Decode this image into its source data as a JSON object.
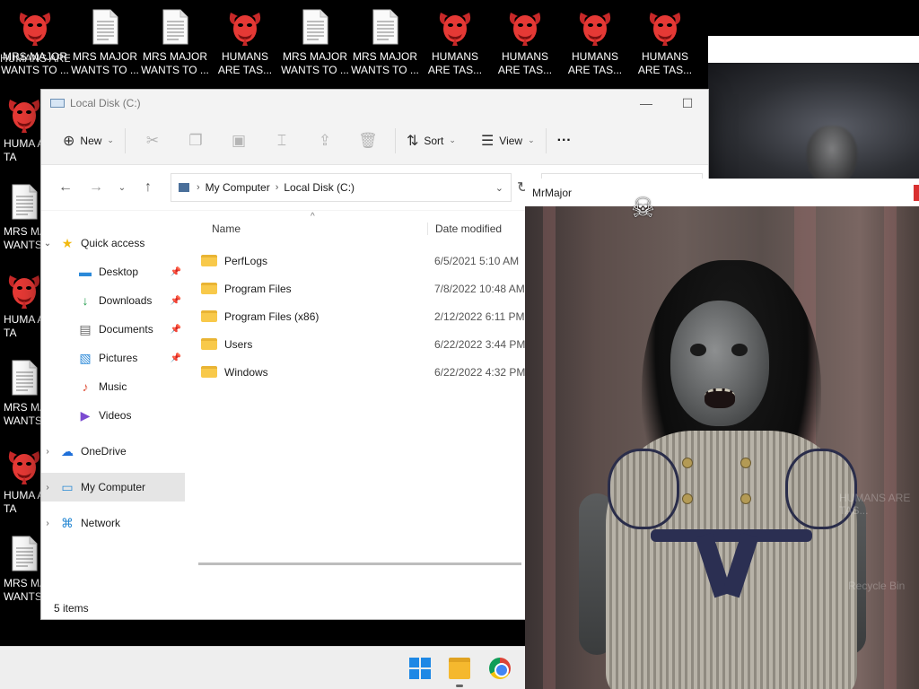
{
  "desktop": {
    "top_row": [
      {
        "label": "MRS MAJOR WANTS TO ...",
        "icon": "devil-icon",
        "overlay": "HUMANS ARE TAS..."
      },
      {
        "label": "MRS MAJOR WANTS TO ...",
        "icon": "doc-icon"
      },
      {
        "label": "MRS MAJOR WANTS TO ...",
        "icon": "doc-icon"
      },
      {
        "label": "HUMANS ARE TAS...",
        "icon": "devil-icon"
      },
      {
        "label": "MRS MAJOR WANTS TO ...",
        "icon": "doc-icon"
      },
      {
        "label": "MRS MAJOR WANTS TO ...",
        "icon": "doc-icon"
      },
      {
        "label": "HUMANS ARE TAS...",
        "icon": "devil-icon"
      },
      {
        "label": "HUMANS ARE TAS...",
        "icon": "devil-icon"
      },
      {
        "label": "HUMANS ARE TAS...",
        "icon": "devil-icon"
      },
      {
        "label": "HUMANS ARE TAS...",
        "icon": "devil-icon"
      }
    ],
    "left_column": [
      {
        "label": "HUMA ARE TA",
        "icon": "devil-icon"
      },
      {
        "label": "MRS MA WANTS",
        "icon": "doc-icon"
      },
      {
        "label": "HUMA ARE TA",
        "icon": "devil-icon"
      },
      {
        "label": "MRS MA WANTS",
        "icon": "doc-icon"
      },
      {
        "label": "HUMA ARE TA",
        "icon": "devil-icon"
      },
      {
        "label": "MRS MA WANTS",
        "icon": "doc-icon"
      }
    ]
  },
  "explorer": {
    "title": "Local Disk (C:)",
    "toolbar": {
      "new_label": "New",
      "sort_label": "Sort",
      "view_label": "View",
      "more_label": "···"
    },
    "address": {
      "crumbs": [
        "My Computer",
        "Local Disk (C:)"
      ]
    },
    "nav": {
      "quick_access": "Quick access",
      "items": [
        {
          "label": "Desktop",
          "pinned": true
        },
        {
          "label": "Downloads",
          "pinned": true
        },
        {
          "label": "Documents",
          "pinned": true
        },
        {
          "label": "Pictures",
          "pinned": true
        },
        {
          "label": "Music",
          "pinned": false
        },
        {
          "label": "Videos",
          "pinned": false
        }
      ],
      "onedrive": "OneDrive",
      "my_computer": "My Computer",
      "network": "Network"
    },
    "columns": {
      "name": "Name",
      "date": "Date modified"
    },
    "files": [
      {
        "name": "PerfLogs",
        "date": "6/5/2021 5:10 AM"
      },
      {
        "name": "Program Files",
        "date": "7/8/2022 10:48 AM"
      },
      {
        "name": "Program Files (x86)",
        "date": "2/12/2022 6:11 PM"
      },
      {
        "name": "Users",
        "date": "6/22/2022 3:44 PM"
      },
      {
        "name": "Windows",
        "date": "6/22/2022 4:32 PM"
      }
    ],
    "status": "5 items"
  },
  "mrmajor": {
    "title": "MrMajor",
    "skull": "☠",
    "ghost_overlay": "HUMANS ARE TAS...",
    "ghost_overlay2": "Recycle Bin"
  },
  "colors": {
    "accent": "#1e88e5",
    "folder": "#f8c94a",
    "close_red": "#d93030"
  }
}
